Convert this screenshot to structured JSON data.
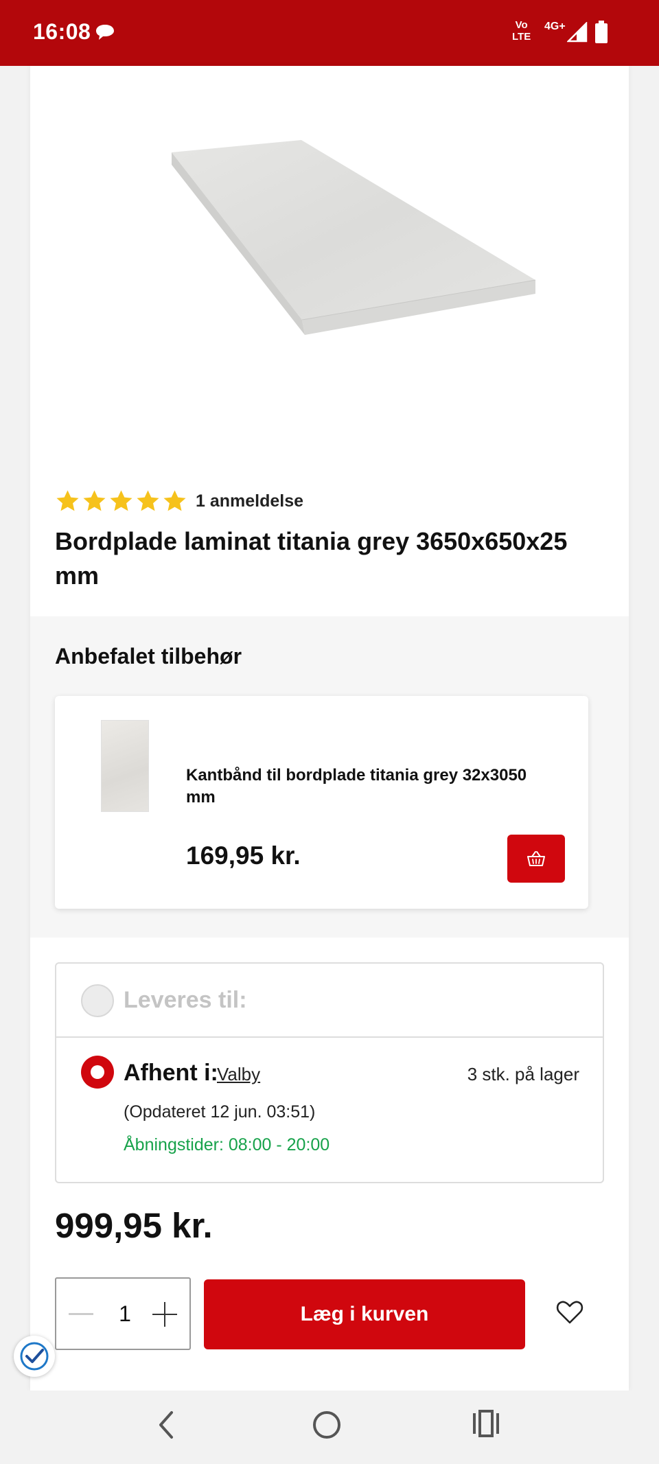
{
  "status_bar": {
    "time": "16:08",
    "volte_top": "Vo",
    "volte_bottom": "LTE",
    "network": "4G+"
  },
  "product": {
    "review_count": "1 anmeldelse",
    "rating": 5,
    "rating_max": 5,
    "title": "Bordplade laminat titania grey 3650x650x25 mm"
  },
  "accessories": {
    "heading": "Anbefalet tilbehør",
    "items": [
      {
        "name": "Kantbånd til bordplade titania grey 32x3050 mm",
        "price": "169,95 kr."
      }
    ]
  },
  "fulfillment": {
    "delivery_label": "Leveres til:",
    "pickup_label": "Afhent i:",
    "pickup_store": "Valby",
    "stock": "3 stk. på lager",
    "updated": "(Opdateret 12 jun. 03:51)",
    "hours": "Åbningstider: 08:00 - 20:00"
  },
  "purchase": {
    "price": "999,95 kr.",
    "quantity": "1",
    "add_to_cart_label": "Læg i kurven"
  },
  "colors": {
    "brand_red": "#d0070e",
    "status_bar_red": "#b3070b",
    "star_yellow": "#f6c21c",
    "hours_green": "#17a24a"
  },
  "icons": [
    "message-icon",
    "signal-icon",
    "battery-icon",
    "star-icon",
    "basket-icon",
    "heart-icon",
    "check-badge-icon",
    "back-icon",
    "home-icon",
    "recent-apps-icon"
  ]
}
